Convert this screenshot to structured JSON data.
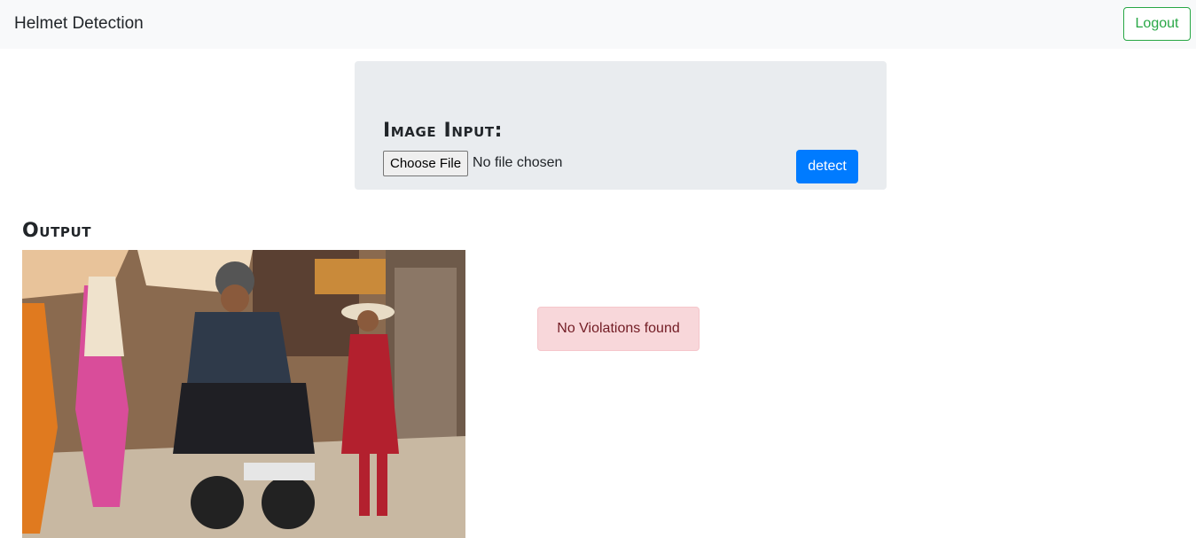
{
  "navbar": {
    "brand": "Helmet Detection",
    "logout_label": "Logout",
    "accent_color": "#28a745"
  },
  "input_panel": {
    "title": "Image Input:",
    "choose_file_label": "Choose File",
    "file_status": "No file chosen",
    "detect_label": "detect",
    "detect_color": "#007bff"
  },
  "output": {
    "title": "Output",
    "image_description_icon": "street-photo",
    "alert_text": "No Violations found",
    "alert_color": "#f8d7da"
  }
}
